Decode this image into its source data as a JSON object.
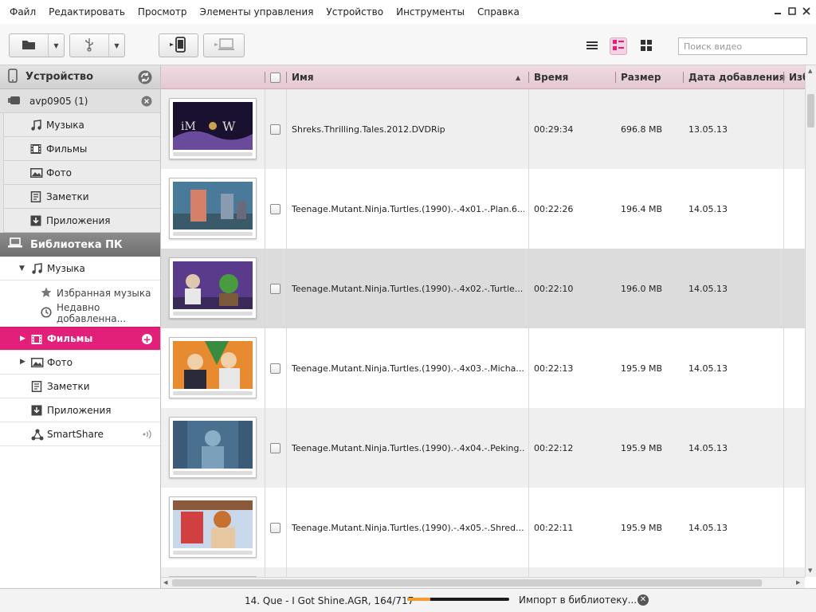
{
  "menu": [
    "Файл",
    "Редактировать",
    "Просмотр",
    "Элементы управления",
    "Устройство",
    "Инструменты",
    "Справка"
  ],
  "search": {
    "placeholder": "Поиск видео"
  },
  "sidebar": {
    "device_header": "Устройство",
    "device_name": "avp0905 (1)",
    "device_items": [
      "Музыка",
      "Фильмы",
      "Фото",
      "Заметки",
      "Приложения"
    ],
    "pc_header": "Библиотека ПК",
    "music": "Музыка",
    "music_sub": [
      "Избранная музыка",
      "Недавно добавленна..."
    ],
    "films": "Фильмы",
    "photo": "Фото",
    "notes": "Заметки",
    "apps": "Приложения",
    "smartshare": "SmartShare"
  },
  "table": {
    "headers": {
      "name": "Имя",
      "time": "Время",
      "size": "Размер",
      "date": "Дата добавления",
      "fav": "Изб"
    },
    "rows": [
      {
        "name": "Shreks.Thrilling.Tales.2012.DVDRip",
        "time": "00:29:34",
        "size": "696.8 MB",
        "date": "13.05.13"
      },
      {
        "name": "Teenage.Mutant.Ninja.Turtles.(1990).-.4x01.-.Plan.6...",
        "time": "00:22:26",
        "size": "196.4 MB",
        "date": "14.05.13"
      },
      {
        "name": "Teenage.Mutant.Ninja.Turtles.(1990).-.4x02.-.Turtle...",
        "time": "00:22:10",
        "size": "196.0 MB",
        "date": "14.05.13"
      },
      {
        "name": "Teenage.Mutant.Ninja.Turtles.(1990).-.4x03.-.Micha...",
        "time": "00:22:13",
        "size": "195.9 MB",
        "date": "14.05.13"
      },
      {
        "name": "Teenage.Mutant.Ninja.Turtles.(1990).-.4x04.-.Peking...",
        "time": "00:22:12",
        "size": "195.9 MB",
        "date": "14.05.13"
      },
      {
        "name": "Teenage.Mutant.Ninja.Turtles.(1990).-.4x05.-.Shred...",
        "time": "00:22:11",
        "size": "195.9 MB",
        "date": "14.05.13"
      }
    ]
  },
  "status": {
    "now_playing": "14. Que - I Got Shine.AGR, 164/717",
    "progress": 0.23,
    "import": "Импорт в библиотеку..."
  },
  "colors": {
    "accent": "#e2207a",
    "header": "#e8cfd8",
    "progress": "#f39a2e"
  },
  "icons": [
    "folder-icon",
    "usb-icon",
    "phone-sync-icon",
    "pc-sync-icon",
    "list-view-icon",
    "detail-view-icon",
    "grid-view-icon",
    "refresh-icon",
    "close-icon",
    "music-icon",
    "film-icon",
    "photo-icon",
    "notes-icon",
    "apps-icon",
    "star-icon",
    "clock-icon",
    "plus-icon",
    "smartshare-icon",
    "signal-icon"
  ]
}
